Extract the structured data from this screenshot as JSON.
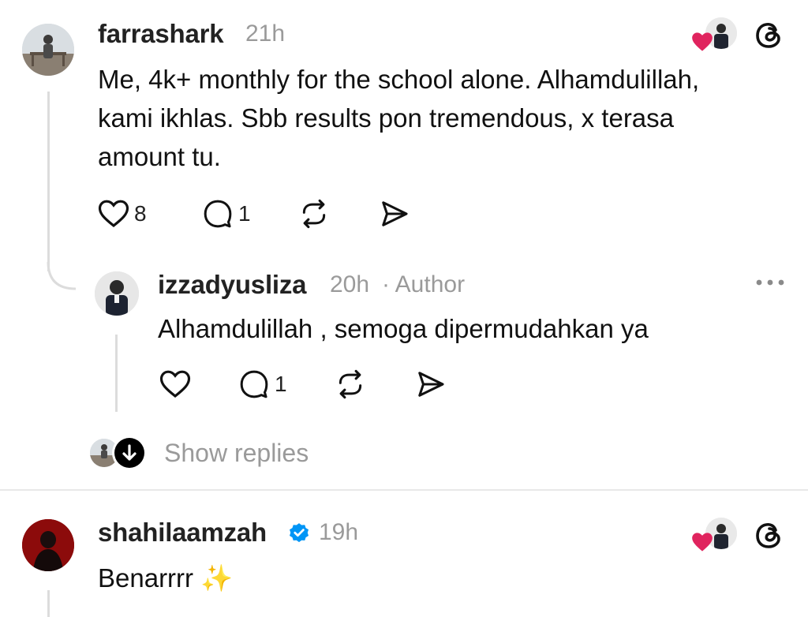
{
  "post1": {
    "username": "farrashark",
    "time": "21h",
    "text_lines": [
      "Me, 4k+ monthly for the school alone. Alhamdulillah,",
      "kami ikhlas. Sbb results pon tremendous, x terasa",
      "amount tu."
    ],
    "likes": "8",
    "replies": "1"
  },
  "reply1": {
    "username": "izzadyusliza",
    "time": "20h",
    "author_tag": "· Author",
    "text": "Alhamdulillah , semoga dipermudahkan ya",
    "likes": "",
    "replies": "1"
  },
  "show_replies": {
    "label": "Show replies"
  },
  "post2": {
    "username": "shahilaamzah",
    "time": "19h",
    "text": "Benarrrr ✨",
    "verified": true
  },
  "colors": {
    "heart_red": "#e0245e",
    "verified_blue": "#0095f6",
    "muted": "#9a9a9a"
  },
  "icons": [
    "heart-icon",
    "comment-icon",
    "repost-icon",
    "share-icon",
    "threads-logo-icon",
    "more-icon",
    "arrow-down-icon",
    "verified-icon"
  ]
}
